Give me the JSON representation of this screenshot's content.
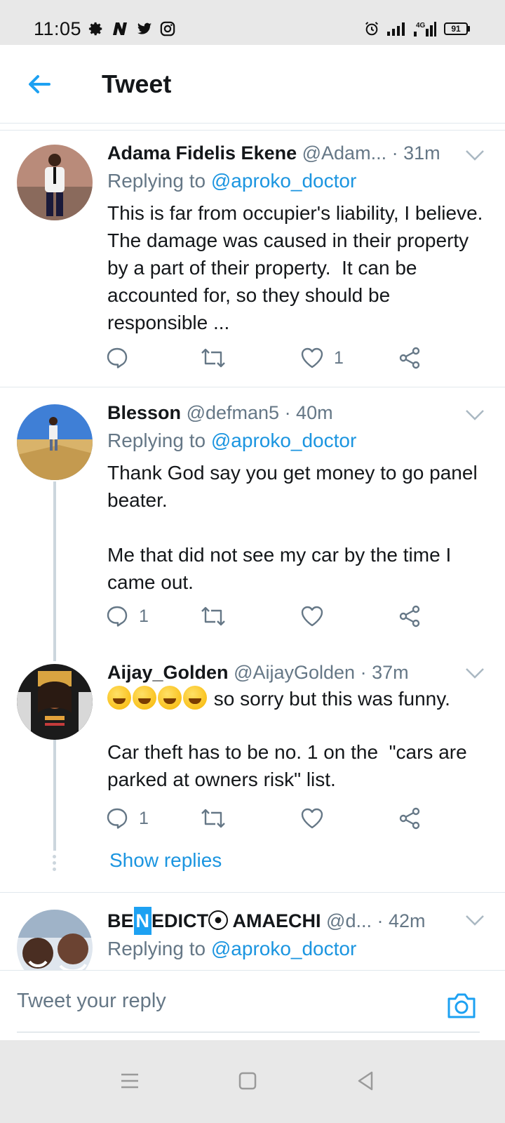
{
  "status_bar": {
    "time": "11:05",
    "battery": "91",
    "network": "4G",
    "icons": [
      "gear-icon",
      "n-app-icon",
      "twitter-icon",
      "instagram-icon",
      "alarm-icon",
      "signal-icon",
      "signal-4g-icon",
      "battery-icon"
    ]
  },
  "header": {
    "title": "Tweet",
    "back_icon": "arrow-left-icon"
  },
  "tweets": [
    {
      "name": "Adama Fidelis Ekene",
      "handle": "@Adam...",
      "time": "· 31m",
      "replying_prefix": "Replying to ",
      "replying_to": "@aproko_doctor",
      "text": "This is far from occupier's liability, I believe. The damage was caused in their property by a part of their property.  It can be accounted for, so they should be responsible ...",
      "reply_count": "",
      "like_count": "1"
    },
    {
      "name": "Blesson",
      "handle": "@defman5",
      "time": "· 40m",
      "replying_prefix": "Replying to ",
      "replying_to": "@aproko_doctor",
      "text": "Thank God say you get money to go panel beater.\n\nMe that did not see my car by the time I came out.",
      "reply_count": "1",
      "like_count": ""
    },
    {
      "name": "Aijay_Golden",
      "handle": "@AijayGolden",
      "time": "· 37m",
      "text_first_line": " so sorry but this was funny.",
      "text": "Car theft has to be no. 1 on the  \"cars are parked at owners risk\" list.",
      "reply_count": "1",
      "like_count": "",
      "show_replies": "Show replies"
    },
    {
      "name_part1": "BE",
      "name_part2": "N",
      "name_part3": "EDICT",
      "name_part4": " AMAECHI",
      "handle": "@d...",
      "time": "· 42m",
      "replying_prefix": "Replying to ",
      "replying_to": "@aproko_doctor"
    }
  ],
  "reply_bar": {
    "placeholder": "Tweet your reply",
    "camera_icon": "camera-icon"
  },
  "nav_bar": {
    "icons": [
      "menu-icon",
      "home-square-icon",
      "back-triangle-icon"
    ]
  },
  "colors": {
    "accent": "#1b95e0",
    "secondary_text": "#657786",
    "divider": "#e1e8ed",
    "system_bar": "#e8e8e8"
  }
}
